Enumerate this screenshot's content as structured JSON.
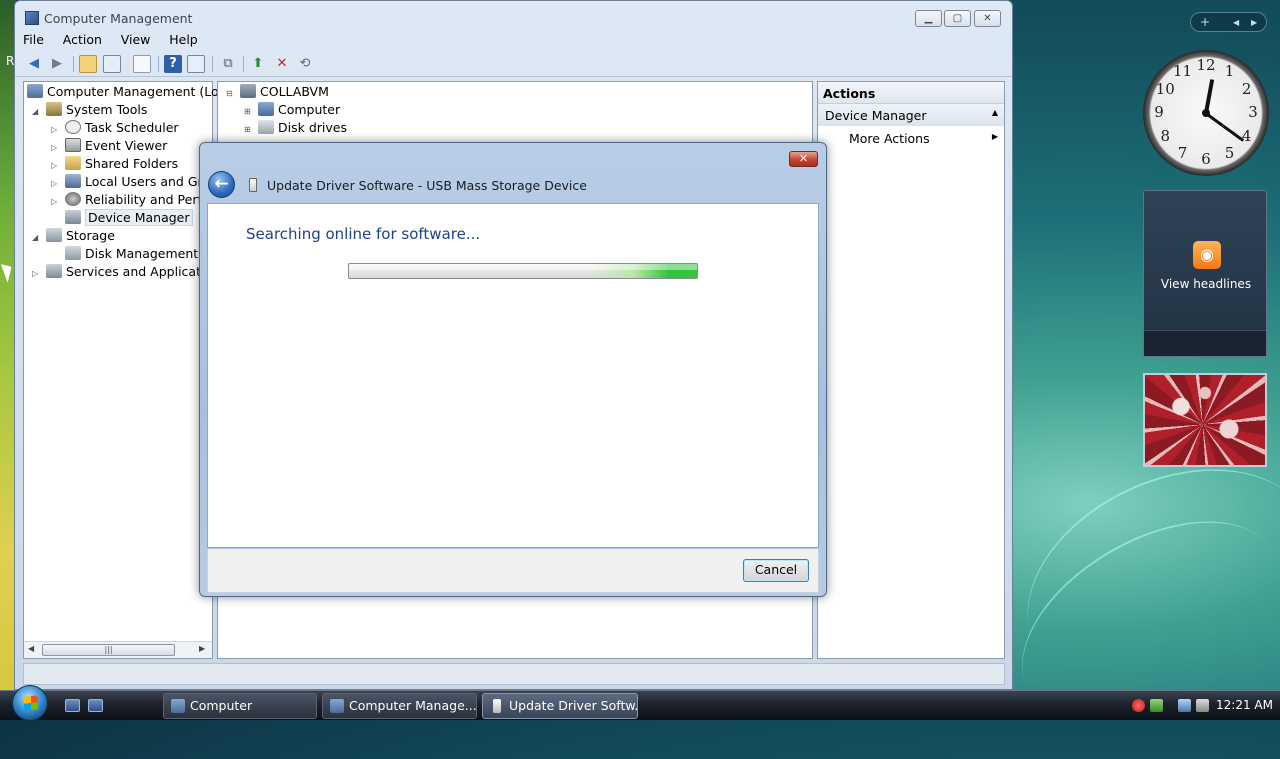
{
  "window": {
    "title": "Computer Management",
    "menu": [
      "File",
      "Action",
      "View",
      "Help"
    ]
  },
  "tree": {
    "root": "Computer Management (Local",
    "system_tools": "System Tools",
    "items": [
      "Task Scheduler",
      "Event Viewer",
      "Shared Folders",
      "Local Users and Group",
      "Reliability and Perform",
      "Device Manager"
    ],
    "storage": "Storage",
    "storage_items": [
      "Disk Management"
    ],
    "services": "Services and Applications"
  },
  "center": {
    "root": "COLLABVM",
    "items": [
      "Computer",
      "Disk drives"
    ]
  },
  "actions": {
    "header": "Actions",
    "section": "Device Manager",
    "more": "More Actions"
  },
  "dialog": {
    "title": "Update Driver Software - USB Mass Storage Device",
    "heading": "Searching online for software...",
    "cancel": "Cancel",
    "progress_fraction": 1.0
  },
  "sidebar": {
    "add": "+",
    "rss_label": "View headlines"
  },
  "taskbar": {
    "tasks": [
      "Computer",
      "Computer Manage...",
      "Update Driver Softw..."
    ],
    "time": "12:21 AM"
  },
  "clock": {
    "hour": 12,
    "minute": 21,
    "numbers": [
      "12",
      "1",
      "2",
      "3",
      "4",
      "5",
      "6",
      "7",
      "8",
      "9",
      "10",
      "11"
    ]
  },
  "desktop": {
    "edge_text": "R"
  },
  "colors": {
    "dialog_heading": "#1e3f8e",
    "progress_green": "#2fc33b",
    "close_red": "#c5452e"
  }
}
